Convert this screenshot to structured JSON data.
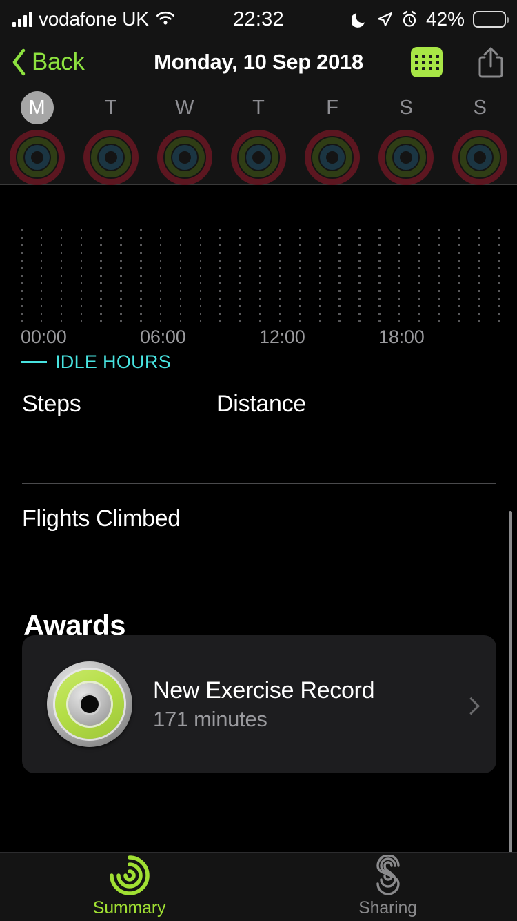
{
  "status_bar": {
    "carrier": "vodafone UK",
    "time": "22:32",
    "battery_percent": "42%",
    "icons": [
      "signal-bars-icon",
      "wifi-icon",
      "do-not-disturb-moon-icon",
      "location-arrow-icon",
      "alarm-clock-icon",
      "battery-icon"
    ]
  },
  "nav_bar": {
    "back_label": "Back",
    "title": "Monday, 10 Sep 2018",
    "calendar_icon": "calendar-icon",
    "share_icon": "share-icon"
  },
  "week_strip": {
    "days": [
      {
        "letter": "M",
        "selected": true
      },
      {
        "letter": "T",
        "selected": false
      },
      {
        "letter": "W",
        "selected": false
      },
      {
        "letter": "T",
        "selected": false
      },
      {
        "letter": "F",
        "selected": false
      },
      {
        "letter": "S",
        "selected": false
      },
      {
        "letter": "S",
        "selected": false
      }
    ],
    "ring_colors": {
      "move": "#5c1620",
      "exercise": "#2f3d15",
      "stand": "#1b3542"
    }
  },
  "chart_data": {
    "type": "scatter",
    "title": "",
    "xlabel": "",
    "ylabel": "",
    "x_ticks": [
      "00:00",
      "06:00",
      "12:00",
      "18:00"
    ],
    "x_tick_positions": [
      0,
      25,
      50,
      75
    ],
    "xlim": [
      0,
      24
    ],
    "grid": "dot-grid",
    "grid_columns": 25,
    "grid_rows": 13,
    "series": [
      {
        "name": "IDLE HOURS",
        "color": "#48e3e0",
        "values": []
      }
    ],
    "legend": [
      {
        "label": "IDLE HOURS",
        "color": "#48e3e0",
        "marker": "line"
      }
    ],
    "legend_position": "bottom-left"
  },
  "metrics": {
    "steps_label": "Steps",
    "steps_value": "",
    "distance_label": "Distance",
    "distance_value": "",
    "flights_label": "Flights Climbed",
    "flights_value": ""
  },
  "awards": {
    "section_title": "Awards",
    "items": [
      {
        "title": "New Exercise Record",
        "subtitle": "171 minutes",
        "badge_icon": "exercise-medal-icon",
        "chevron_icon": "chevron-right-icon"
      }
    ]
  },
  "tab_bar": {
    "tabs": [
      {
        "label": "Summary",
        "icon": "activity-rings-spiral-icon",
        "active": true
      },
      {
        "label": "Sharing",
        "icon": "sharing-figures-icon",
        "active": false
      }
    ],
    "active_color": "#a0e033",
    "inactive_color": "#8a8a8c"
  }
}
